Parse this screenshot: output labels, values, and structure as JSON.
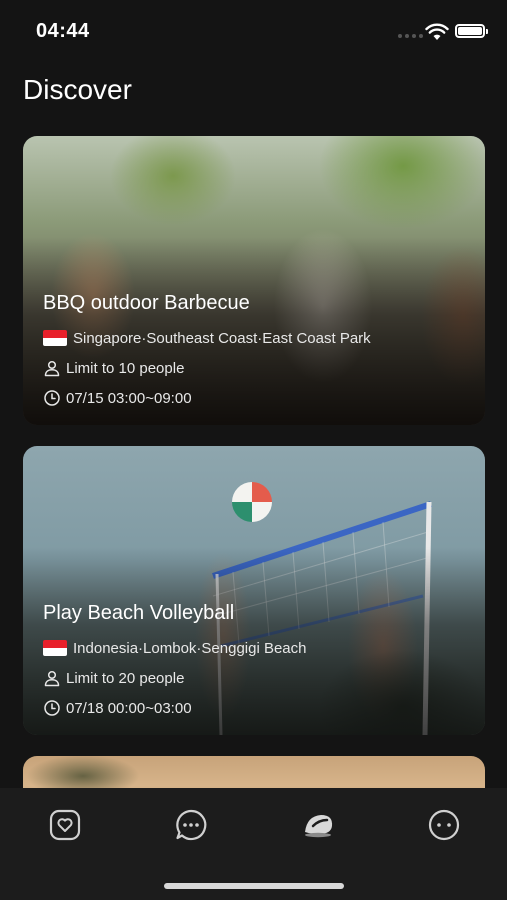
{
  "status_bar": {
    "time": "04:44"
  },
  "header": {
    "title": "Discover"
  },
  "events": [
    {
      "title": "BBQ outdoor Barbecue",
      "flag": "singapore-flag",
      "location": "Singapore·Southeast Coast·East Coast Park",
      "limit": "Limit to 10 people",
      "time": "07/15 03:00~09:00"
    },
    {
      "title": "Play Beach Volleyball",
      "flag": "indonesia-flag",
      "location": "Indonesia·Lombok·Senggigi Beach",
      "limit": "Limit to 20 people",
      "time": "07/18 00:00~03:00"
    }
  ],
  "tab_bar": {
    "items": [
      {
        "icon": "heart-tab-icon"
      },
      {
        "icon": "chat-tab-icon"
      },
      {
        "icon": "discover-tab-icon",
        "active": true
      },
      {
        "icon": "more-tab-icon"
      }
    ]
  },
  "colors": {
    "background": "#141414",
    "tab_bar": "#1c1c1c",
    "text": "#ffffff",
    "icon": "#d0d0d0"
  }
}
